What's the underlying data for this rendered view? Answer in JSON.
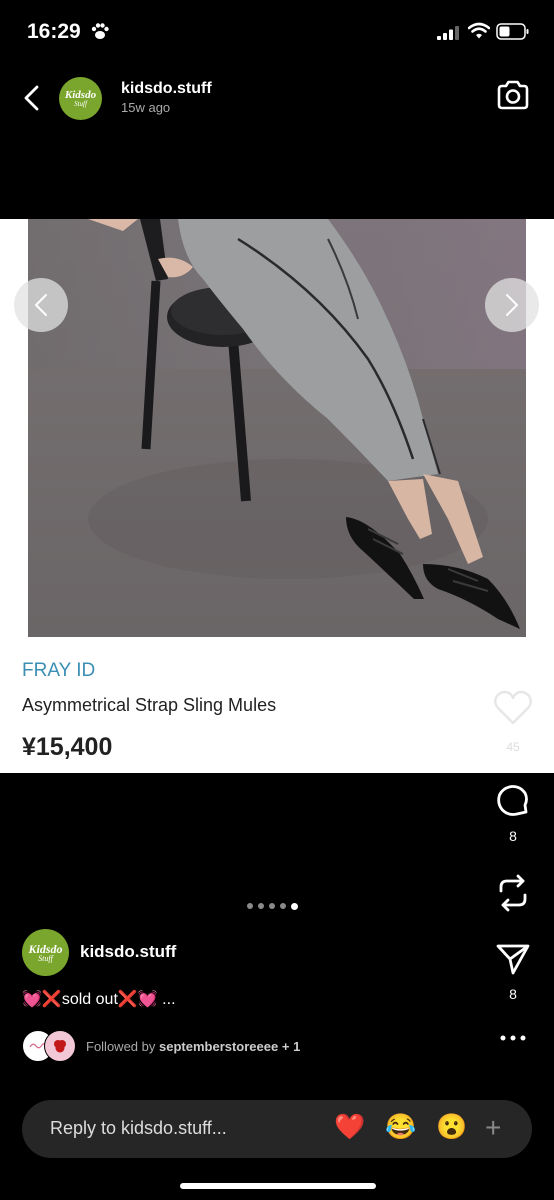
{
  "status_bar": {
    "time": "16:29"
  },
  "header": {
    "username": "kidsdo.stuff",
    "post_age": "15w ago",
    "avatar_text": "Kidsdo",
    "avatar_sub": "Stuff"
  },
  "product": {
    "brand": "FRAY ID",
    "name": "Asymmetrical Strap Sling Mules",
    "price": "¥15,400",
    "likes": "45"
  },
  "actions": {
    "comment_count": "8",
    "send_count": "8"
  },
  "carousel": {
    "total": 5,
    "active_index": 4
  },
  "caption": {
    "username": "kidsdo.stuff",
    "text": "💓❌sold out❌💓 ...",
    "followed_prefix": "Followed by",
    "followed_user": "septemberstoreeee",
    "followed_suffix": "+ 1"
  },
  "reply": {
    "placeholder": "Reply to kidsdo.stuff...",
    "quick_reactions": [
      "❤️",
      "😂",
      "😮"
    ],
    "plus": "+"
  },
  "colors": {
    "brand_text": "#3b8fb5",
    "avatar_green": "#7aa62e",
    "background": "#000000"
  }
}
